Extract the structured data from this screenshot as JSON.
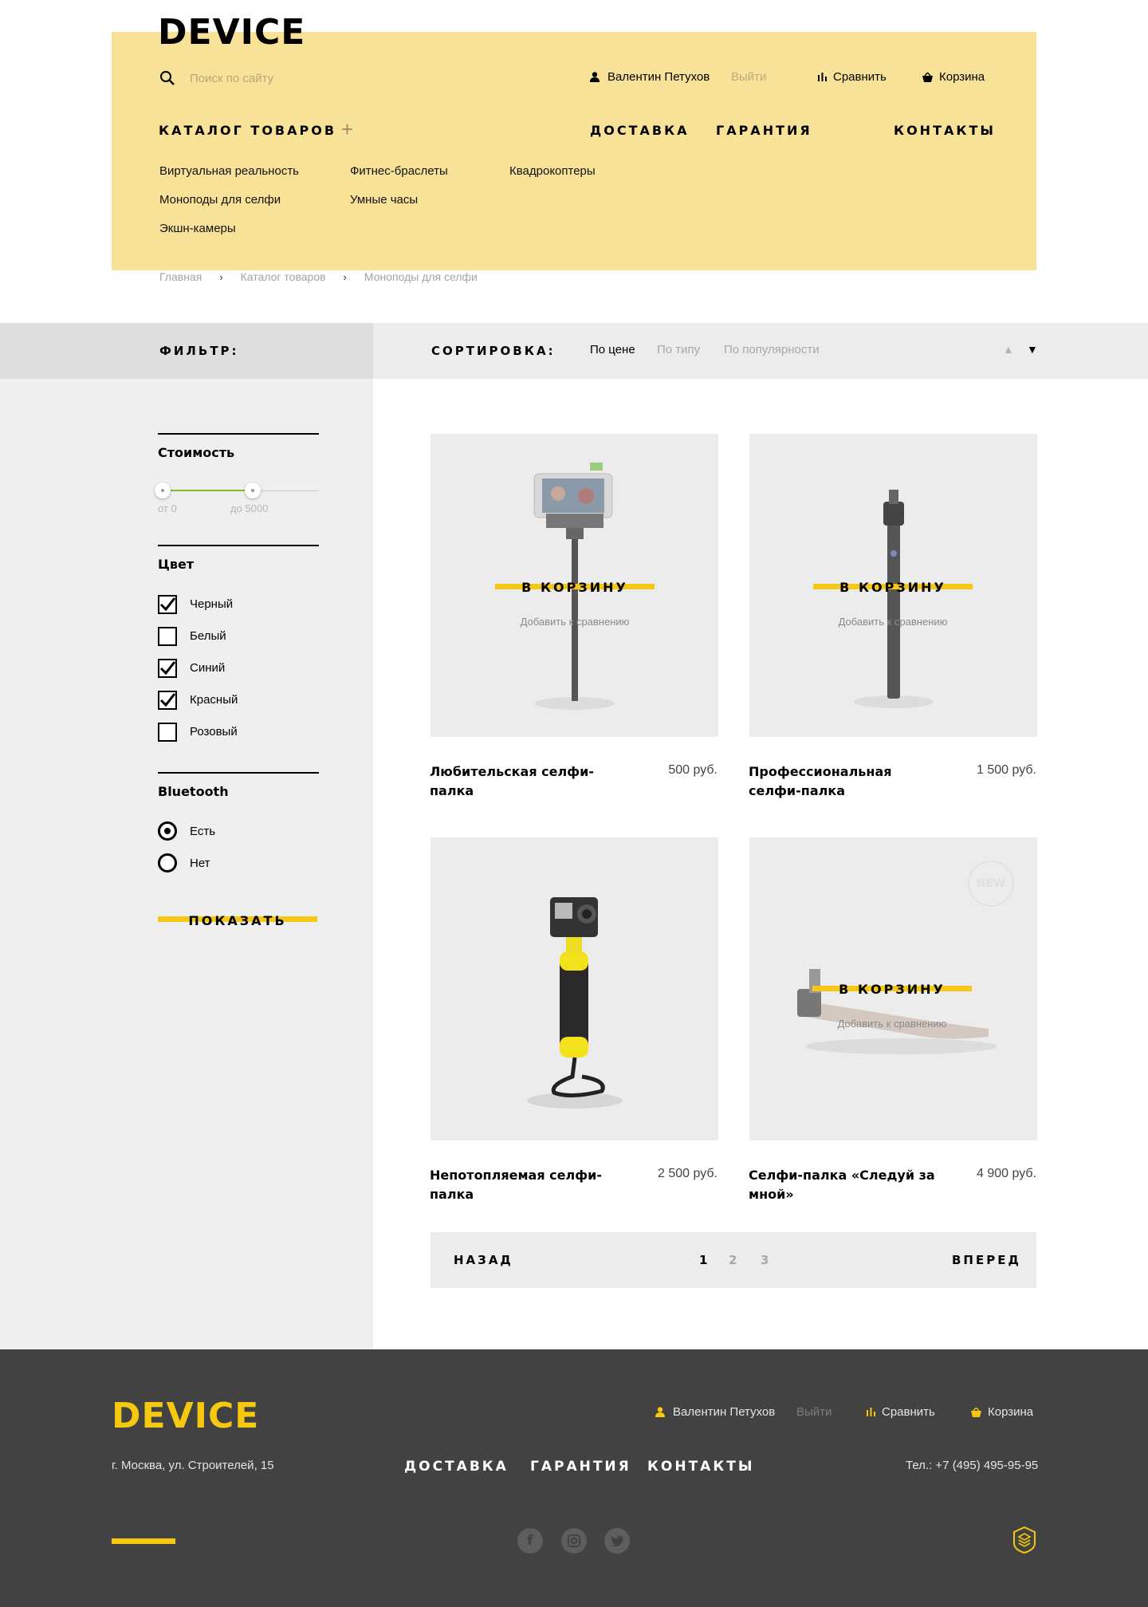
{
  "brand": {
    "logo": "DEVICE",
    "accent": "#f5c815",
    "panel": "#f8e298"
  },
  "header": {
    "search_placeholder": "Поиск по сайту",
    "user": "Валентин Петухов",
    "logout": "Выйти",
    "compare": "Сравнить",
    "cart": "Корзина"
  },
  "nav": {
    "catalog": "КАТАЛОГ ТОВАРОВ",
    "catalog_icon": "plus-icon",
    "delivery": "ДОСТАВКА",
    "warranty": "ГАРАНТИЯ",
    "contacts": "КОНТАКТЫ"
  },
  "submenu": [
    "Виртуальная реальность",
    "Фитнес-браслеты",
    "Квадрокоптеры",
    "Моноподы для селфи",
    "Умные часы",
    "Экшн-камеры"
  ],
  "breadcrumbs": [
    "Главная",
    "Каталог товаров",
    "Моноподы для селфи"
  ],
  "filter": {
    "title": "ФИЛЬТР:",
    "price_title": "Стоимость",
    "price_from": "от 0",
    "price_to": "до 5000",
    "color_title": "Цвет",
    "colors": [
      {
        "label": "Черный",
        "checked": true
      },
      {
        "label": "Белый",
        "checked": false
      },
      {
        "label": "Синий",
        "checked": true
      },
      {
        "label": "Красный",
        "checked": true
      },
      {
        "label": "Розовый",
        "checked": false
      }
    ],
    "bluetooth_title": "Bluetooth",
    "bluetooth": [
      {
        "label": "Есть",
        "selected": true
      },
      {
        "label": "Нет",
        "selected": false
      }
    ],
    "show_button": "ПОКАЗАТЬ"
  },
  "sort": {
    "title": "СОРТИРОВКА:",
    "options": [
      "По цене",
      "По типу",
      "По популярности"
    ],
    "active": "По цене"
  },
  "products": [
    {
      "name": "Любительская селфи-палка",
      "price": "500 руб.",
      "cart": "В КОРЗИНУ",
      "compare": "Добавить к сравнению"
    },
    {
      "name": "Профессиональная селфи-палка",
      "price": "1 500 руб.",
      "cart": "В КОРЗИНУ",
      "compare": "Добавить к сравнению"
    },
    {
      "name": "Непотопляемая селфи-палка",
      "price": "2 500 руб."
    },
    {
      "name": "Селфи-палка «Следуй за мной»",
      "price": "4 900 руб.",
      "cart": "В КОРЗИНУ",
      "compare": "Добавить к сравнению",
      "badge": "NEW"
    }
  ],
  "pagination": {
    "prev": "НАЗАД",
    "next": "ВПЕРЕД",
    "pages": [
      "1",
      "2",
      "3"
    ],
    "current": "1"
  },
  "footer": {
    "logo": "DEVICE",
    "address": "г. Москва, ул. Строителей, 15",
    "user": "Валентин Петухов",
    "logout": "Выйти",
    "compare": "Сравнить",
    "cart": "Корзина",
    "delivery": "ДОСТАВКА",
    "warranty": "ГАРАНТИЯ",
    "contacts": "КОНТАКТЫ",
    "phone": "Тел.: +7 (495) 495-95-95",
    "social_icons": [
      "facebook-icon",
      "instagram-icon",
      "twitter-icon"
    ]
  }
}
